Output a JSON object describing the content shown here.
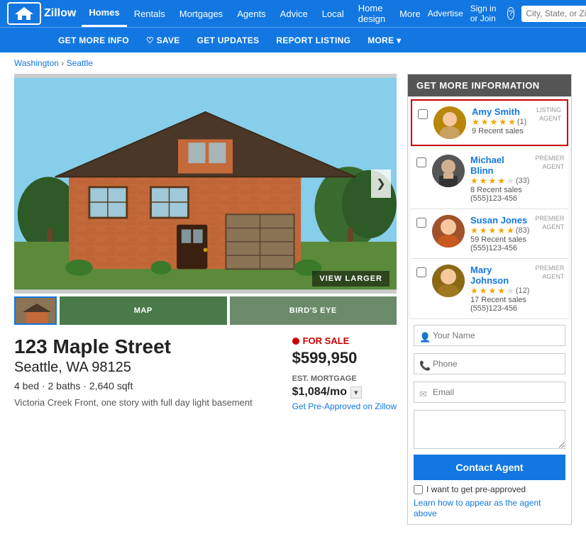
{
  "header": {
    "logo": "Z",
    "logo_text": "Zillow",
    "nav": [
      {
        "label": "Homes",
        "active": true
      },
      {
        "label": "Rentals",
        "active": false
      },
      {
        "label": "Mortgages",
        "active": false
      },
      {
        "label": "Agents",
        "active": false
      },
      {
        "label": "Advice",
        "active": false
      },
      {
        "label": "Local",
        "active": false
      },
      {
        "label": "Home design",
        "active": false
      },
      {
        "label": "More",
        "active": false
      }
    ],
    "right_links": [
      "Advertise",
      "Sign in or Join",
      "?"
    ],
    "search_placeholder": "City, State, or Zip",
    "sub_nav": [
      {
        "label": "GET MORE INFO",
        "icon": ""
      },
      {
        "label": "♡ SAVE",
        "icon": ""
      },
      {
        "label": "GET UPDATES",
        "icon": ""
      },
      {
        "label": "REPORT LISTING",
        "icon": ""
      },
      {
        "label": "MORE ▾",
        "icon": ""
      }
    ]
  },
  "breadcrumb": {
    "items": [
      "Washington",
      "Seattle"
    ]
  },
  "property": {
    "address": "123 Maple Street",
    "city_state_zip": "Seattle, WA 98125",
    "specs": "4 bed · 2 baths · 2,640 sqft",
    "description": "Victoria Creek Front, one story with full day light basement",
    "status": "FOR SALE",
    "price": "$599,950",
    "est_mortgage_label": "EST. MORTGAGE",
    "est_mortgage": "$1,084/mo",
    "mortgage_icon": "▾",
    "get_preapproved_link": "Get Pre-Approved on Zillow",
    "view_larger": "VIEW LARGER",
    "next_arrow": "❯",
    "map_btn": "MAP",
    "birds_eye_btn": "BIRD'S EYE"
  },
  "info_panel": {
    "header": "GET MORE INFORMATION",
    "agents": [
      {
        "name": "Amy Smith",
        "stars": 5,
        "review_count": "(1)",
        "sales": "9 Recent sales",
        "phone": "",
        "badge": "LISTING\nAGENT",
        "listing_agent": true,
        "avatar_color": "#b8860b"
      },
      {
        "name": "Michael Blinn",
        "stars": 4,
        "review_count": "(33)",
        "sales": "8 Recent sales",
        "phone": "(555)123-456",
        "badge": "PREMIER\nAGENT",
        "listing_agent": false,
        "avatar_color": "#555"
      },
      {
        "name": "Susan Jones",
        "stars": 5,
        "review_count": "(83)",
        "sales": "59 Recent sales",
        "phone": "(555)123-456",
        "badge": "PREMIER\nAGENT",
        "listing_agent": false,
        "avatar_color": "#a0522d"
      },
      {
        "name": "Mary Johnson",
        "stars": 4,
        "review_count": "(12)",
        "sales": "17 Recent sales",
        "phone": "(555)123-456",
        "badge": "PREMIER\nAGENT",
        "listing_agent": false,
        "avatar_color": "#8b6914"
      }
    ],
    "form": {
      "name_placeholder": "Your Name",
      "phone_placeholder": "Phone",
      "email_placeholder": "Email",
      "message_placeholder": "",
      "contact_btn": "Contact Agent",
      "preapproved_label": "I want to get pre-approved",
      "learn_link": "Learn how to appear as the agent above"
    }
  }
}
